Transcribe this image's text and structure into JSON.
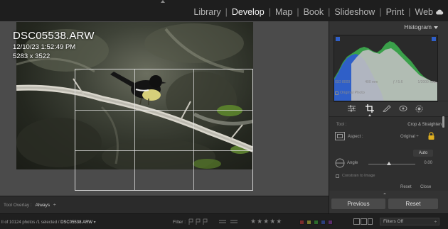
{
  "modules": [
    "Library",
    "Develop",
    "Map",
    "Book",
    "Slideshow",
    "Print",
    "Web"
  ],
  "active_module": "Develop",
  "photo_info": {
    "filename": "DSC05538.ARW",
    "datetime": "12/10/23 1:52:49 PM",
    "dimensions": "5283 x 3522"
  },
  "toolbar": {
    "overlay_label": "Tool Overlay :",
    "overlay_value": "Always",
    "overlay_arrow": "÷"
  },
  "histogram": {
    "title": "Histogram",
    "exif": {
      "iso": "ISO 8000",
      "focal": "400 mm",
      "aperture": "ƒ / 5.6",
      "shutter": "1/2000 sec"
    },
    "original_label": "Original Photo"
  },
  "crop": {
    "tool_label": "Tool :",
    "tool_name": "Crop & Straighten",
    "aspect_label": "Aspect :",
    "aspect_value": "Original ÷",
    "auto_label": "Auto",
    "angle_label": "Angle",
    "angle_value": "0.00",
    "constrain_label": "Constrain to Image",
    "reset_label": "Reset",
    "close_label": "Close"
  },
  "buttons": {
    "previous": "Previous",
    "reset": "Reset"
  },
  "filmstrip": {
    "count_text": "ll of 10124 photos /1 selected /",
    "selected_file": "DSC05538.ARW",
    "selected_arrow": "▾",
    "filter_label": "Filter :",
    "stars": "★★★★★",
    "filters_off": "Filters Off",
    "filters_off_arrow": "÷"
  },
  "colors": {
    "accent_blue": "#2f5fc8",
    "hist_green": "#3aa04a",
    "flag_red": "#7a2b2b",
    "flag_yellow": "#7a7a2b",
    "flag_green": "#2b6a2b",
    "flag_blue": "#2b3f7a",
    "flag_purple": "#5a2b6a"
  }
}
